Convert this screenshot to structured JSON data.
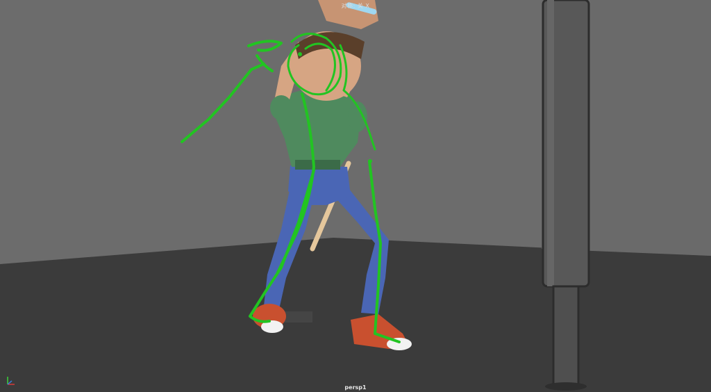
{
  "viewport": {
    "hud_top_text": "对称: 关 X",
    "camera_label": "persp1"
  },
  "colors": {
    "wall": "#6c6c6c",
    "floor": "#3b3b3b",
    "pillar": "#555555",
    "sketch_stroke": "#22c422",
    "shirt": "#4f8a5e",
    "pants": "#4a66b5",
    "skin": "#d6a583",
    "shoe": "#c9502f",
    "hair": "#5a3f2a"
  },
  "icons": {
    "axis_gizmo": "xyz-axis-icon"
  }
}
